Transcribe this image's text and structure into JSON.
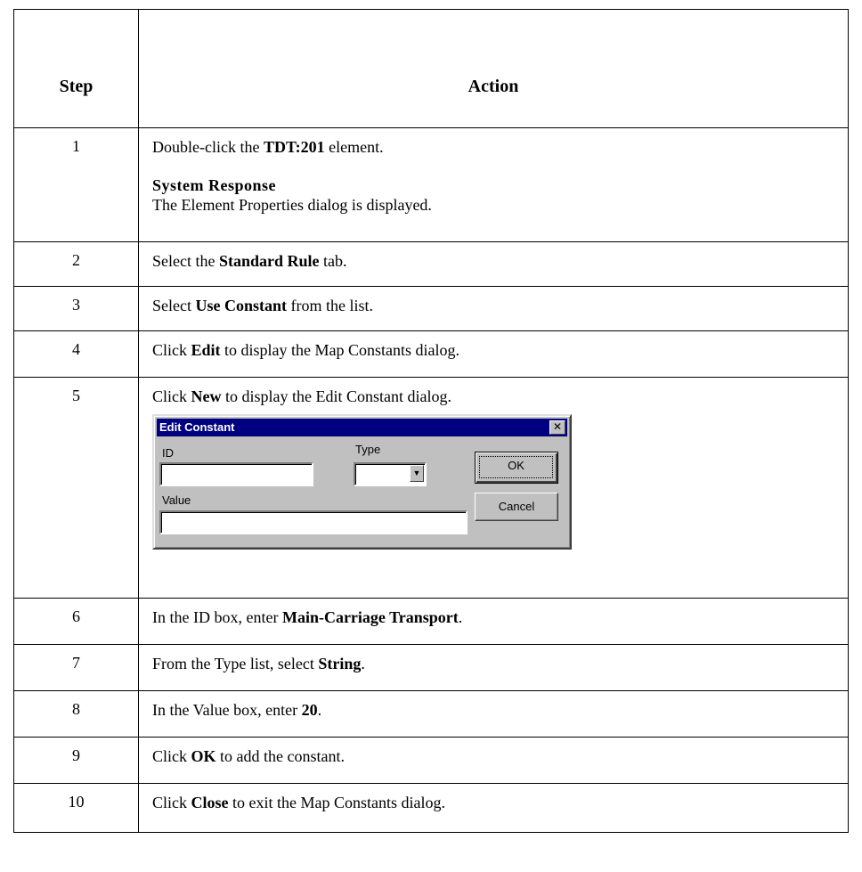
{
  "table": {
    "header": {
      "step": "Step",
      "action": "Action"
    },
    "rows": [
      {
        "num": "1",
        "parts": [
          {
            "t": "Double-click the "
          },
          {
            "b": "TDT:201"
          },
          {
            "t": " element."
          }
        ],
        "system_response_title": "System Response",
        "system_response_text": "The Element Properties dialog is displayed."
      },
      {
        "num": "2",
        "parts": [
          {
            "t": "Select the "
          },
          {
            "b": "Standard Rule"
          },
          {
            "t": " tab."
          }
        ]
      },
      {
        "num": "3",
        "parts": [
          {
            "t": "Select "
          },
          {
            "b": "Use Constant"
          },
          {
            "t": " from the list."
          }
        ]
      },
      {
        "num": "4",
        "parts": [
          {
            "t": "Click "
          },
          {
            "b": "Edit"
          },
          {
            "t": " to display the Map Constants dialog."
          }
        ]
      },
      {
        "num": "5",
        "parts": [
          {
            "t": "Click "
          },
          {
            "b": "New"
          },
          {
            "t": " to display the Edit Constant dialog."
          }
        ]
      },
      {
        "num": "6",
        "parts": [
          {
            "t": "In the ID box, enter "
          },
          {
            "b": "Main-Carriage Transport"
          },
          {
            "t": "."
          }
        ]
      },
      {
        "num": "7",
        "parts": [
          {
            "t": "From the Type list, select "
          },
          {
            "b": "String"
          },
          {
            "t": "."
          }
        ]
      },
      {
        "num": "8",
        "parts": [
          {
            "t": "In the Value box, enter "
          },
          {
            "b": "20"
          },
          {
            "t": "."
          }
        ]
      },
      {
        "num": "9",
        "parts": [
          {
            "t": "Click "
          },
          {
            "b": "OK"
          },
          {
            "t": " to add the constant."
          }
        ]
      },
      {
        "num": "10",
        "parts": [
          {
            "t": "Click "
          },
          {
            "b": "Close"
          },
          {
            "t": " to exit the Map Constants dialog."
          }
        ]
      }
    ]
  },
  "dialog": {
    "title": "Edit Constant",
    "close_icon": "close-icon",
    "id_label": "ID",
    "id_value": "",
    "type_label": "Type",
    "type_value": "",
    "value_label": "Value",
    "value_value": "",
    "ok_label": "OK",
    "cancel_label": "Cancel",
    "dropdown_icon": "chevron-down-icon"
  }
}
